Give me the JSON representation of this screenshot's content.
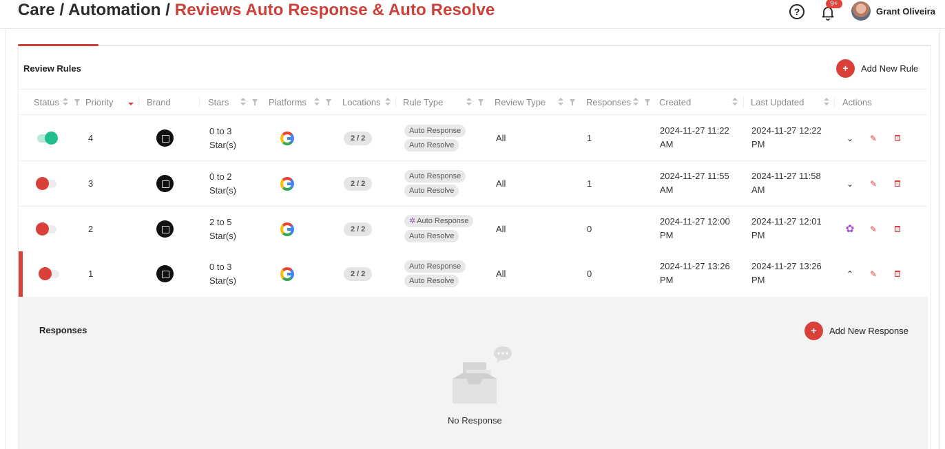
{
  "header": {
    "crumb_1": "Care / Automation / ",
    "crumb_active": "Reviews Auto Response & Auto Resolve",
    "help_symbol": "?",
    "notifications_badge": "9+",
    "user_name": "Grant Oliveira"
  },
  "card": {
    "title": "Review Rules",
    "add_rule_label": "Add New Rule",
    "plus_symbol": "+"
  },
  "columns": {
    "status": "Status",
    "priority": "Priority",
    "brand": "Brand",
    "stars": "Stars",
    "platforms": "Platforms",
    "locations": "Locations",
    "rule_type": "Rule Type",
    "review_type": "Review Type",
    "responses": "Responses",
    "created": "Created",
    "last_updated": "Last Updated",
    "actions": "Actions"
  },
  "rows": [
    {
      "enabled": true,
      "priority": "4",
      "stars_line1": "0 to 3",
      "stars_line2": "Star(s)",
      "locations": "2 / 2",
      "rule_type_1": "Auto Response",
      "rule_type_2": "Auto Resolve",
      "review_type": "All",
      "responses": "1",
      "created_1": "2024-11-27 11:22",
      "created_2": "AM",
      "updated_1": "2024-11-27 12:22",
      "updated_2": "PM"
    },
    {
      "enabled": false,
      "priority": "3",
      "stars_line1": "0 to 2",
      "stars_line2": "Star(s)",
      "locations": "2 / 2",
      "rule_type_1": "Auto Response",
      "rule_type_2": "Auto Resolve",
      "review_type": "All",
      "responses": "1",
      "created_1": "2024-11-27 11:55",
      "created_2": "AM",
      "updated_1": "2024-11-27 11:58",
      "updated_2": "AM"
    },
    {
      "enabled": false,
      "priority": "2",
      "stars_line1": "2 to 5",
      "stars_line2": "Star(s)",
      "locations": "2 / 2",
      "rule_type_1": "Auto Response",
      "rule_type_2": "Auto Resolve",
      "review_type": "All",
      "responses": "0",
      "created_1": "2024-11-27 12:00",
      "created_2": "PM",
      "updated_1": "2024-11-27 12:01",
      "updated_2": "PM"
    },
    {
      "enabled": false,
      "priority": "1",
      "stars_line1": "0 to 3",
      "stars_line2": "Star(s)",
      "locations": "2 / 2",
      "rule_type_1": "Auto Response",
      "rule_type_2": "Auto Resolve",
      "review_type": "All",
      "responses": "0",
      "created_1": "2024-11-27 13:26",
      "created_2": "PM",
      "updated_1": "2024-11-27 13:26",
      "updated_2": "PM"
    }
  ],
  "icons": {
    "chevron_down": "⌄",
    "chevron_up": "⌃",
    "pencil": "✎",
    "spark": "✲",
    "flower": "✿"
  },
  "responses_panel": {
    "title": "Responses",
    "add_response_label": "Add New Response",
    "empty_text": "No Response"
  },
  "colors": {
    "accent": "#d9403a",
    "toggle_on": "#1fbf8f",
    "ai_purple": "#a24bd6"
  }
}
